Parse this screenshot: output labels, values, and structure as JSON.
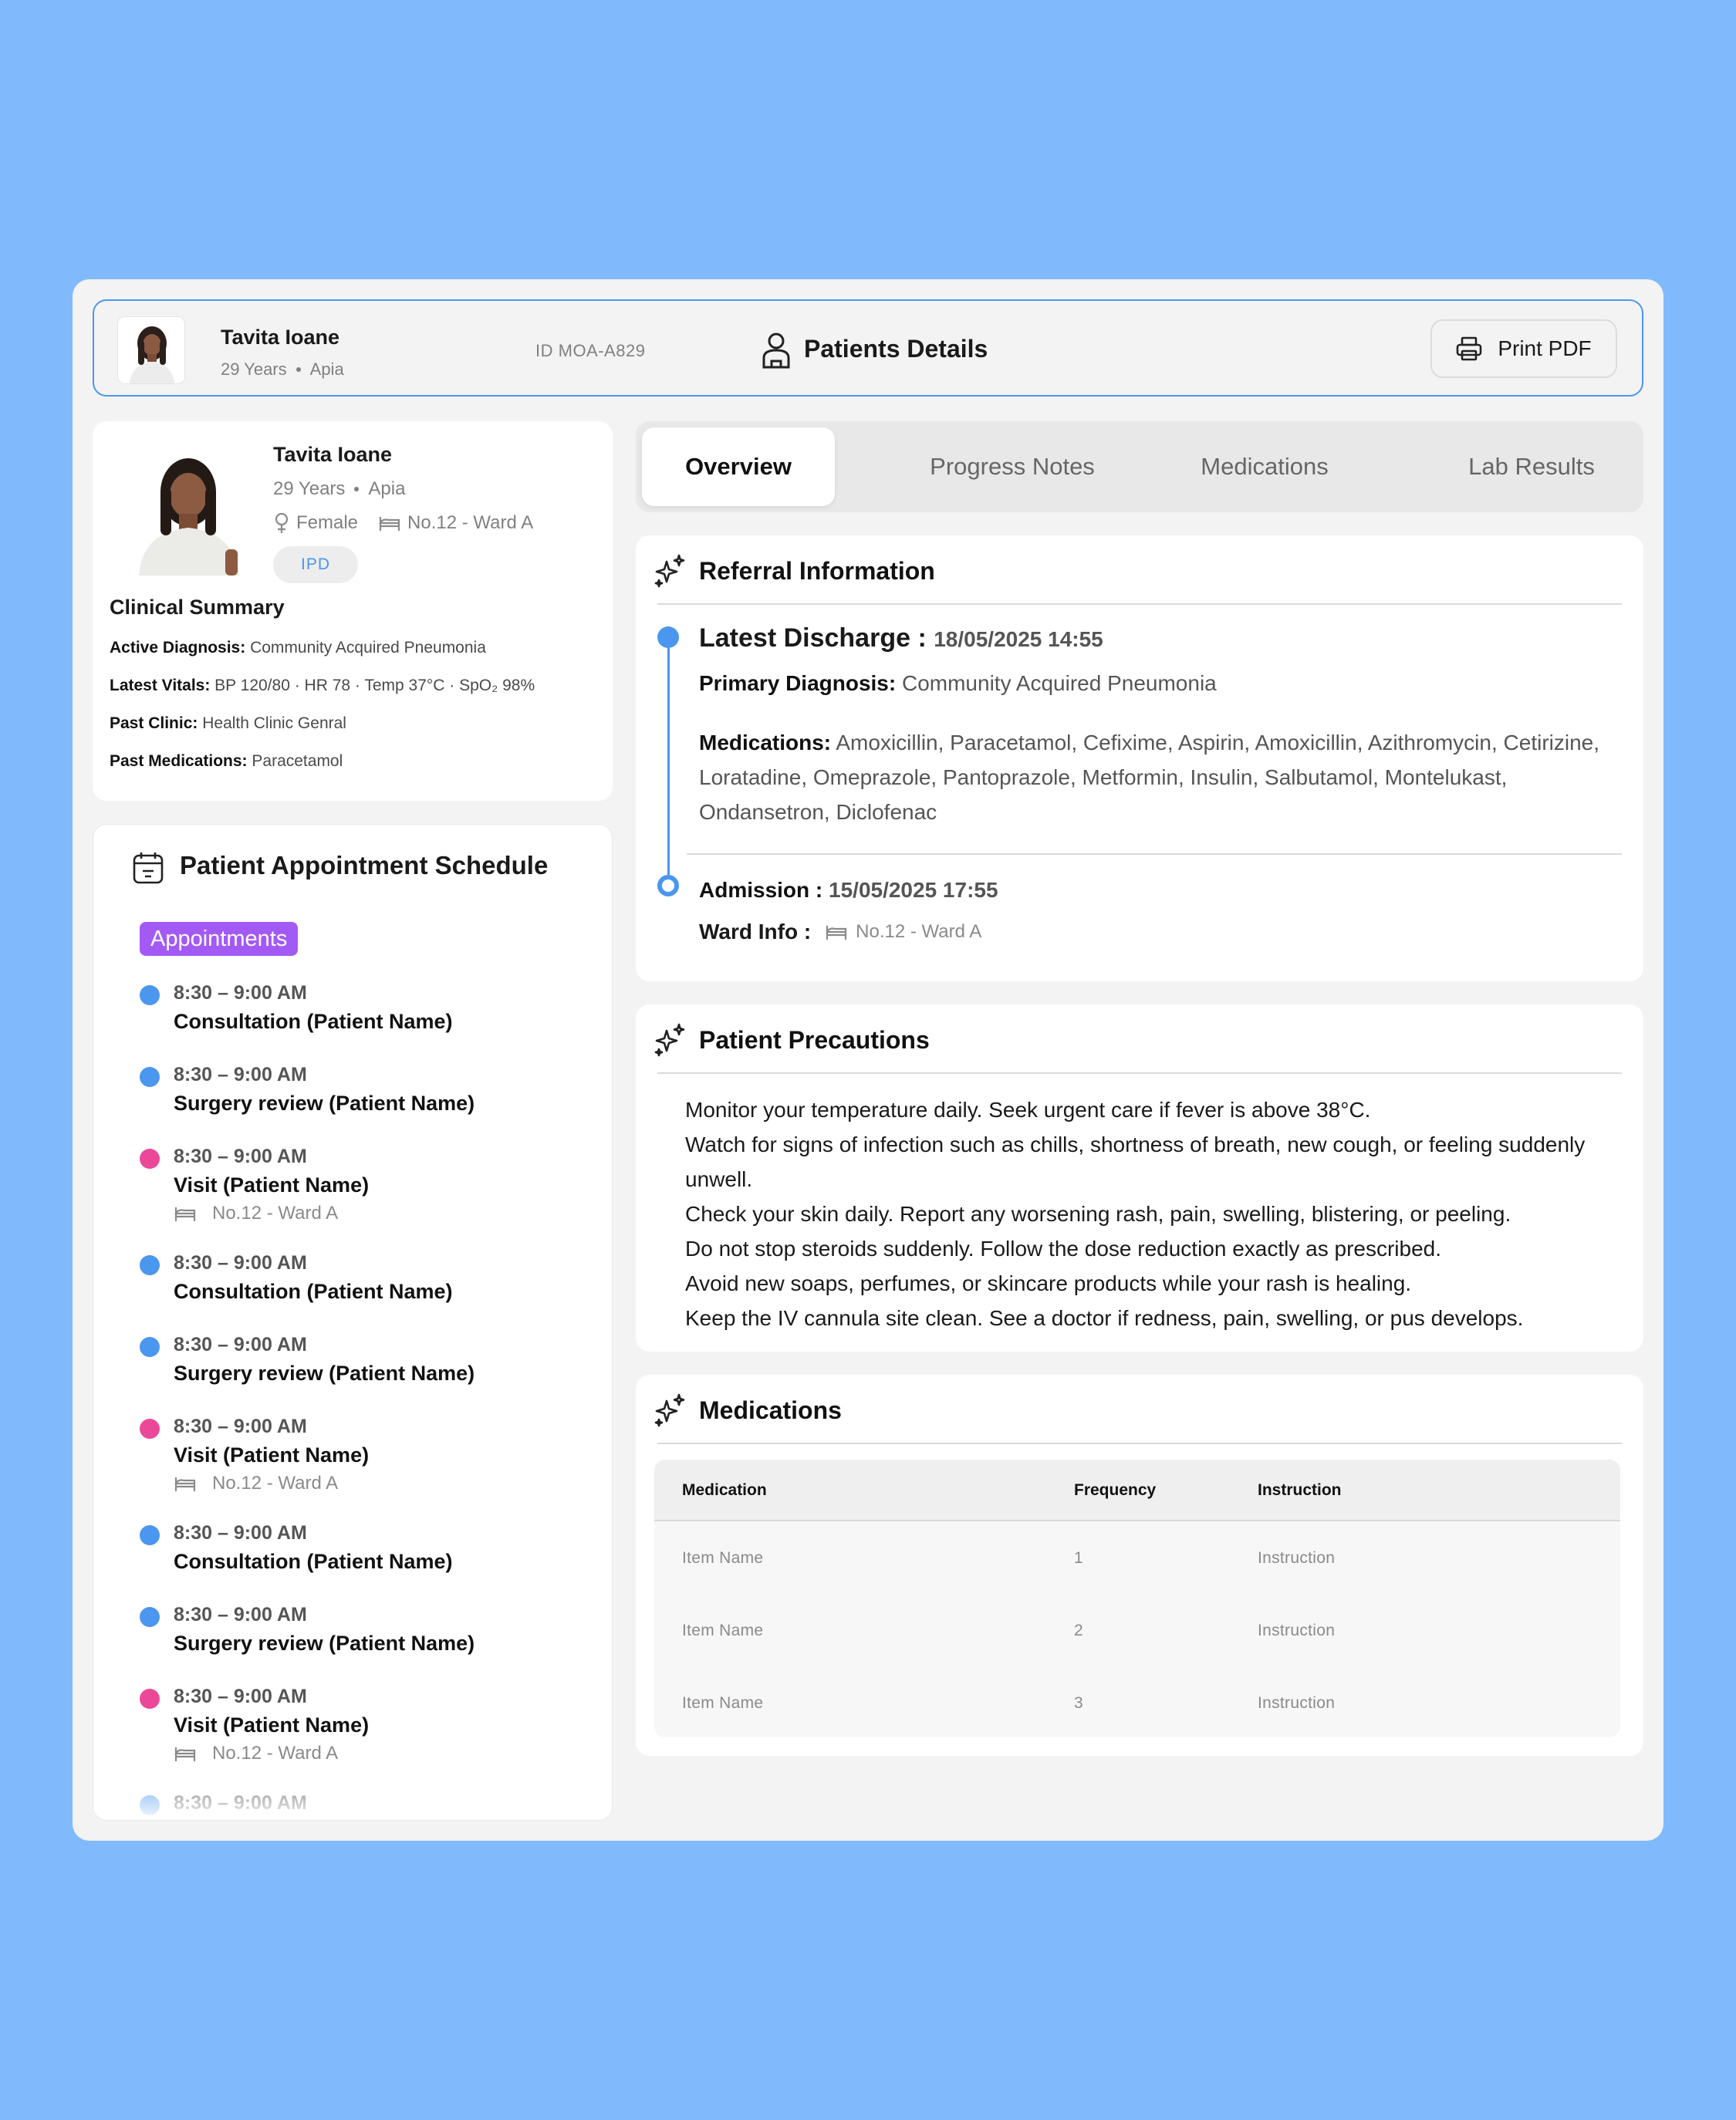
{
  "patient": {
    "name": "Tavita Ioane",
    "age": "29 Years",
    "location": "Apia",
    "gender": "Female",
    "ward": "No.12 - Ward A",
    "id": "ID MOA-A829",
    "type_badge": "IPD"
  },
  "header": {
    "title": "Patients Details",
    "print_label": "Print PDF"
  },
  "clinical_summary": {
    "title": "Clinical Summary",
    "rows": [
      {
        "label": "Active Diagnosis:",
        "value": "Community Acquired Pneumonia"
      },
      {
        "label": "Latest Vitals:",
        "value": "BP 120/80 · HR 78 · Temp 37°C · SpO₂ 98%"
      },
      {
        "label": "Past Clinic:",
        "value": "Health Clinic Genral"
      },
      {
        "label": "Past Medications:",
        "value": "Paracetamol"
      }
    ]
  },
  "schedule": {
    "title": "Patient Appointment Schedule",
    "badge": "Appointments",
    "items": [
      {
        "time": "8:30 – 9:00 AM",
        "title": "Consultation (Patient Name)",
        "color": "#4B96EE",
        "ward": ""
      },
      {
        "time": "8:30 – 9:00 AM",
        "title": "Surgery review (Patient Name)",
        "color": "#4B96EE",
        "ward": ""
      },
      {
        "time": "8:30 – 9:00 AM",
        "title": "Visit (Patient Name)",
        "color": "#EC4899",
        "ward": "No.12 - Ward A"
      },
      {
        "time": "8:30 – 9:00 AM",
        "title": "Consultation (Patient Name)",
        "color": "#4B96EE",
        "ward": ""
      },
      {
        "time": "8:30 – 9:00 AM",
        "title": "Surgery review (Patient Name)",
        "color": "#4B96EE",
        "ward": ""
      },
      {
        "time": "8:30 – 9:00 AM",
        "title": "Visit (Patient Name)",
        "color": "#EC4899",
        "ward": "No.12 - Ward A"
      },
      {
        "time": "8:30 – 9:00 AM",
        "title": "Consultation (Patient Name)",
        "color": "#4B96EE",
        "ward": ""
      },
      {
        "time": "8:30 – 9:00 AM",
        "title": "Surgery review (Patient Name)",
        "color": "#4B96EE",
        "ward": ""
      },
      {
        "time": "8:30 – 9:00 AM",
        "title": "Visit (Patient Name)",
        "color": "#EC4899",
        "ward": "No.12 - Ward A"
      },
      {
        "time": "8:30 – 9:00 AM",
        "title": "",
        "color": "#4B96EE",
        "ward": ""
      }
    ]
  },
  "tabs": [
    {
      "label": "Overview",
      "active": true
    },
    {
      "label": "Progress Notes",
      "active": false
    },
    {
      "label": "Medications",
      "active": false
    },
    {
      "label": "Lab Results",
      "active": false
    }
  ],
  "referral": {
    "title": "Referral Information",
    "latest_discharge_label": "Latest Discharge :",
    "latest_discharge_value": "18/05/2025 14:55",
    "primary_diagnosis_label": "Primary Diagnosis:",
    "primary_diagnosis_value": "Community Acquired Pneumonia",
    "medications_label": "Medications:",
    "medications_value": "Amoxicillin, Paracetamol, Cefixime, Aspirin, Amoxicillin, Azithromycin, Cetirizine, Loratadine, Omeprazole, Pantoprazole, Metformin, Insulin, Salbutamol, Montelukast, Ondansetron, Diclofenac",
    "admission_label": "Admission :",
    "admission_value": "15/05/2025 17:55",
    "ward_info_label": "Ward Info :",
    "ward_info_value": "No.12 - Ward A"
  },
  "precautions": {
    "title": "Patient Precautions",
    "items": [
      "Monitor your temperature daily. Seek urgent care if fever is above 38°C.",
      "Watch for signs of infection such as chills, shortness of breath, new cough, or feeling suddenly unwell.",
      "Check your skin daily. Report any worsening rash, pain, swelling, blistering, or peeling.",
      "Do not stop steroids suddenly. Follow the dose reduction exactly as prescribed.",
      "Avoid new soaps, perfumes, or skincare products while your rash is healing.",
      "Keep the IV cannula site clean. See a doctor if redness, pain, swelling, or pus develops."
    ]
  },
  "medications": {
    "title": "Medications",
    "columns": [
      "Medication",
      "Frequency",
      "Instruction"
    ],
    "rows": [
      [
        "Item Name",
        "1",
        "Instruction"
      ],
      [
        "Item Name",
        "2",
        "Instruction"
      ],
      [
        "Item Name",
        "3",
        "Instruction"
      ]
    ]
  },
  "colors": {
    "page_background": "#80BAFD",
    "accent_blue": "#4B96EE",
    "accent_pink": "#EC4899",
    "badge_purple": "#A35AF4"
  }
}
